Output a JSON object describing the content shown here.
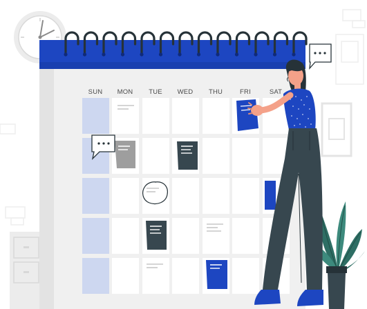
{
  "weekdays": [
    "SUN",
    "MON",
    "TUE",
    "WED",
    "THU",
    "FRI",
    "SAT"
  ],
  "colors": {
    "calendar_header": "#1d46c1",
    "calendar_body": "#f0f0f0",
    "cell": "#ffffff",
    "sunday_cell": "#cdd7f0",
    "dark_note": "#37474f",
    "gray_note": "#9e9e9e",
    "blue_note": "#1d46c1",
    "ring": "#263238",
    "shirt": "#1d46c1",
    "pants": "#37474f",
    "skin": "#f4a189",
    "hair": "#263238",
    "plant_leaf": "#2e6e64",
    "pot": "#37474f"
  },
  "icons": [
    "wall-clock-icon",
    "speech-bubble-icon",
    "ellipsis-icon",
    "calendar-ring-icon",
    "sticky-note-icon",
    "plant-icon"
  ]
}
